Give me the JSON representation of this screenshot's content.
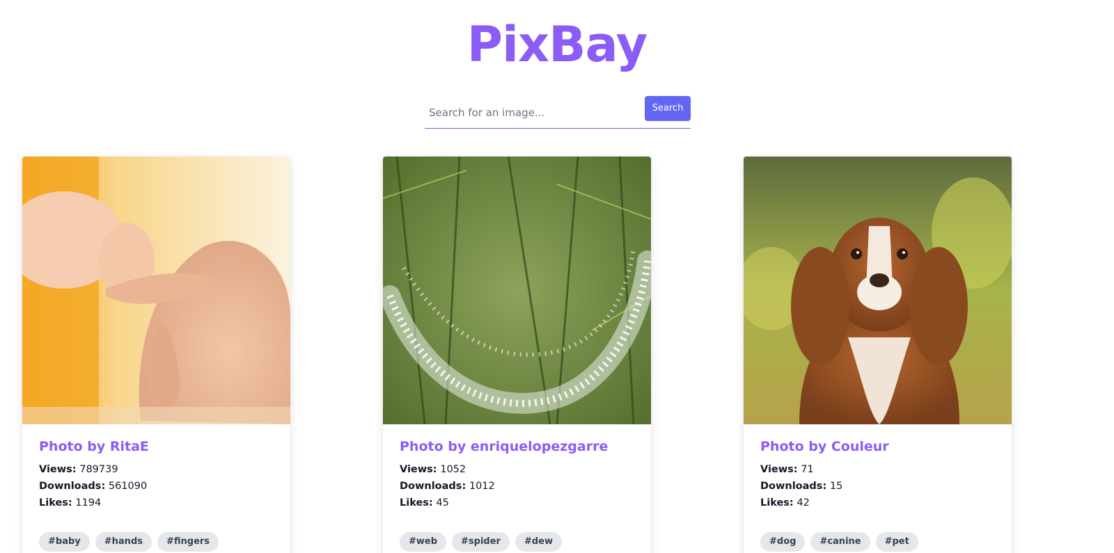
{
  "header": {
    "title": "PixBay"
  },
  "search": {
    "placeholder": "Search for an image...",
    "button_label": "Search"
  },
  "labels": {
    "views": "Views:",
    "downloads": "Downloads:",
    "likes": "Likes:"
  },
  "cards": [
    {
      "title": "Photo by RitaE",
      "views": "789739",
      "downloads": "561090",
      "likes": "1194",
      "tags": [
        "#baby",
        "#hands",
        "#fingers"
      ]
    },
    {
      "title": "Photo by enriquelopezgarre",
      "views": "1052",
      "downloads": "1012",
      "likes": "45",
      "tags": [
        "#web",
        "#spider",
        "#dew"
      ]
    },
    {
      "title": "Photo by Couleur",
      "views": "71",
      "downloads": "15",
      "likes": "42",
      "tags": [
        "#dog",
        "#canine",
        "#pet"
      ]
    }
  ],
  "colors": {
    "brand": "#8b5cf6",
    "button": "#6366f1",
    "tag_bg": "#e5e7eb"
  }
}
